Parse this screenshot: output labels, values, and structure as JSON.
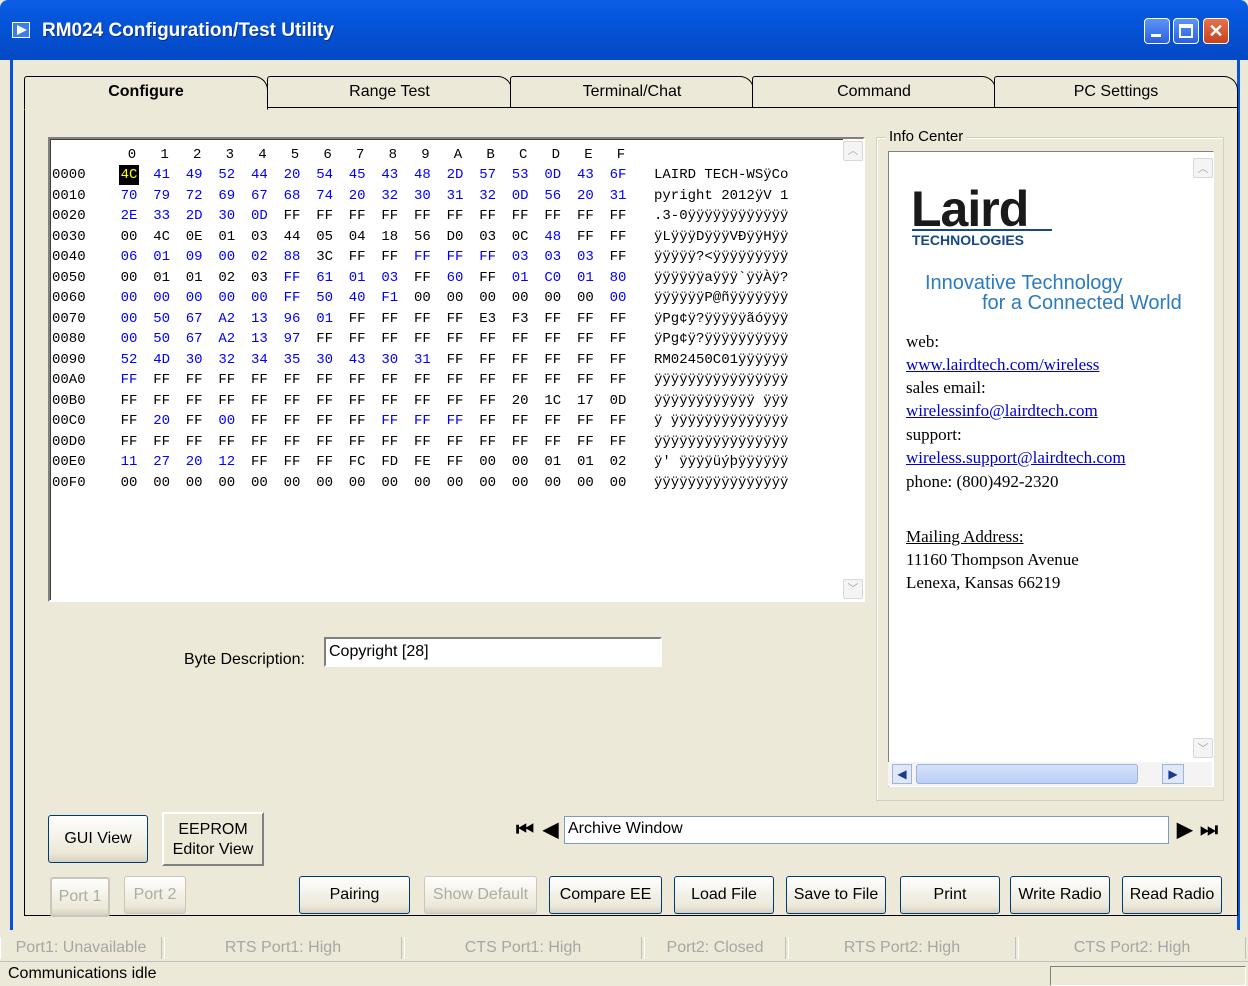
{
  "window": {
    "title": "RM024 Configuration/Test Utility"
  },
  "tabs": [
    "Configure",
    "Range Test",
    "Terminal/Chat",
    "Command",
    "PC Settings"
  ],
  "hex_editor": {
    "columns": [
      "0",
      "1",
      "2",
      "3",
      "4",
      "5",
      "6",
      "7",
      "8",
      "9",
      "A",
      "B",
      "C",
      "D",
      "E",
      "F"
    ],
    "rows": [
      {
        "addr": "0000",
        "bytes": [
          "4C",
          "41",
          "49",
          "52",
          "44",
          "20",
          "54",
          "45",
          "43",
          "48",
          "2D",
          "57",
          "53",
          "0D",
          "43",
          "6F"
        ],
        "ascii": "LAIRD TECH-WSÿCo"
      },
      {
        "addr": "0010",
        "bytes": [
          "70",
          "79",
          "72",
          "69",
          "67",
          "68",
          "74",
          "20",
          "32",
          "30",
          "31",
          "32",
          "0D",
          "56",
          "20",
          "31"
        ],
        "ascii": "pyright 2012ÿV 1"
      },
      {
        "addr": "0020",
        "bytes": [
          "2E",
          "33",
          "2D",
          "30",
          "0D",
          "FF",
          "FF",
          "FF",
          "FF",
          "FF",
          "FF",
          "FF",
          "FF",
          "FF",
          "FF",
          "FF"
        ],
        "ascii": ".3-0ÿÿÿÿÿÿÿÿÿÿÿÿ"
      },
      {
        "addr": "0030",
        "bytes": [
          "00",
          "4C",
          "0E",
          "01",
          "03",
          "44",
          "05",
          "04",
          "18",
          "56",
          "D0",
          "03",
          "0C",
          "48",
          "FF",
          "FF"
        ],
        "ascii": "ÿLÿÿÿDÿÿÿVÐÿÿHÿÿ"
      },
      {
        "addr": "0040",
        "bytes": [
          "06",
          "01",
          "09",
          "00",
          "02",
          "88",
          "3C",
          "FF",
          "FF",
          "FF",
          "FF",
          "FF",
          "03",
          "03",
          "03",
          "FF"
        ],
        "ascii": "ÿÿÿÿÿ?<ÿÿÿÿÿÿÿÿÿ"
      },
      {
        "addr": "0050",
        "bytes": [
          "00",
          "01",
          "01",
          "02",
          "03",
          "FF",
          "61",
          "01",
          "03",
          "FF",
          "60",
          "FF",
          "01",
          "C0",
          "01",
          "80"
        ],
        "ascii": "ÿÿÿÿÿÿaÿÿÿ`ÿÿÀÿ?"
      },
      {
        "addr": "0060",
        "bytes": [
          "00",
          "00",
          "00",
          "00",
          "00",
          "FF",
          "50",
          "40",
          "F1",
          "00",
          "00",
          "00",
          "00",
          "00",
          "00",
          "00"
        ],
        "ascii": "ÿÿÿÿÿÿP@ñÿÿÿÿÿÿÿ"
      },
      {
        "addr": "0070",
        "bytes": [
          "00",
          "50",
          "67",
          "A2",
          "13",
          "96",
          "01",
          "FF",
          "FF",
          "FF",
          "FF",
          "E3",
          "F3",
          "FF",
          "FF",
          "FF"
        ],
        "ascii": "ÿPg¢ÿ?ÿÿÿÿÿãóÿÿÿ"
      },
      {
        "addr": "0080",
        "bytes": [
          "00",
          "50",
          "67",
          "A2",
          "13",
          "97",
          "FF",
          "FF",
          "FF",
          "FF",
          "FF",
          "FF",
          "FF",
          "FF",
          "FF",
          "FF"
        ],
        "ascii": "ÿPg¢ÿ?ÿÿÿÿÿÿÿÿÿÿ"
      },
      {
        "addr": "0090",
        "bytes": [
          "52",
          "4D",
          "30",
          "32",
          "34",
          "35",
          "30",
          "43",
          "30",
          "31",
          "FF",
          "FF",
          "FF",
          "FF",
          "FF",
          "FF"
        ],
        "ascii": "RM02450C01ÿÿÿÿÿÿ"
      },
      {
        "addr": "00A0",
        "bytes": [
          "FF",
          "FF",
          "FF",
          "FF",
          "FF",
          "FF",
          "FF",
          "FF",
          "FF",
          "FF",
          "FF",
          "FF",
          "FF",
          "FF",
          "FF",
          "FF"
        ],
        "ascii": "ÿÿÿÿÿÿÿÿÿÿÿÿÿÿÿÿ"
      },
      {
        "addr": "00B0",
        "bytes": [
          "FF",
          "FF",
          "FF",
          "FF",
          "FF",
          "FF",
          "FF",
          "FF",
          "FF",
          "FF",
          "FF",
          "FF",
          "20",
          "1C",
          "17",
          "0D"
        ],
        "ascii": "ÿÿÿÿÿÿÿÿÿÿÿÿ ÿÿÿ"
      },
      {
        "addr": "00C0",
        "bytes": [
          "FF",
          "20",
          "FF",
          "00",
          "FF",
          "FF",
          "FF",
          "FF",
          "FF",
          "FF",
          "FF",
          "FF",
          "FF",
          "FF",
          "FF",
          "FF"
        ],
        "ascii": "ÿ ÿÿÿÿÿÿÿÿÿÿÿÿÿÿ"
      },
      {
        "addr": "00D0",
        "bytes": [
          "FF",
          "FF",
          "FF",
          "FF",
          "FF",
          "FF",
          "FF",
          "FF",
          "FF",
          "FF",
          "FF",
          "FF",
          "FF",
          "FF",
          "FF",
          "FF"
        ],
        "ascii": "ÿÿÿÿÿÿÿÿÿÿÿÿÿÿÿÿ"
      },
      {
        "addr": "00E0",
        "bytes": [
          "11",
          "27",
          "20",
          "12",
          "FF",
          "FF",
          "FF",
          "FC",
          "FD",
          "FE",
          "FF",
          "00",
          "00",
          "01",
          "01",
          "02"
        ],
        "ascii": "ÿ' ÿÿÿÿüýþÿÿÿÿÿÿ"
      },
      {
        "addr": "00F0",
        "bytes": [
          "00",
          "00",
          "00",
          "00",
          "00",
          "00",
          "00",
          "00",
          "00",
          "00",
          "00",
          "00",
          "00",
          "00",
          "00",
          "00"
        ],
        "ascii": "ÿÿÿÿÿÿÿÿÿÿÿÿÿÿÿÿ"
      }
    ]
  },
  "byte_description": {
    "label": "Byte Description:",
    "value": "Copyright [28]"
  },
  "info_center": {
    "legend": "Info Center",
    "logo": "Laird",
    "logo_sub": "TECHNOLOGIES",
    "tagline_1": "Innovative Technology",
    "tagline_2": "for a Connected World",
    "web_label": "web:",
    "web_link": "www.lairdtech.com/wireless",
    "sales_label": "sales email:",
    "sales_link": "wirelessinfo@lairdtech.com",
    "support_label": "support:",
    "support_link": "wireless.support@lairdtech.com",
    "phone": "phone: (800)492-2320",
    "mailing_label": "Mailing Address:",
    "address_1": "11160 Thompson Avenue",
    "address_2": "Lenexa, Kansas 66219"
  },
  "view_buttons": {
    "gui": "GUI View",
    "eeprom_1": "EEPROM",
    "eeprom_2": "Editor View"
  },
  "archive": {
    "value": "Archive Window"
  },
  "bottom_buttons": {
    "port1": "Port 1",
    "port2": "Port 2",
    "pairing": "Pairing",
    "show_default": "Show Default",
    "compare": "Compare EE",
    "load": "Load File",
    "save": "Save to File",
    "print": "Print",
    "write": "Write Radio",
    "read": "Read Radio"
  },
  "status": {
    "port1": "Port1: Unavailable",
    "rts1": "RTS Port1: High",
    "cts1": "CTS Port1: High",
    "port2": "Port2: Closed",
    "rts2": "RTS Port2: High",
    "cts2": "CTS Port2: High",
    "message": "Communications idle"
  },
  "colors": {
    "title_bar": "#0453d8",
    "hex_blue": "#0000ff",
    "selection": "#000000"
  }
}
